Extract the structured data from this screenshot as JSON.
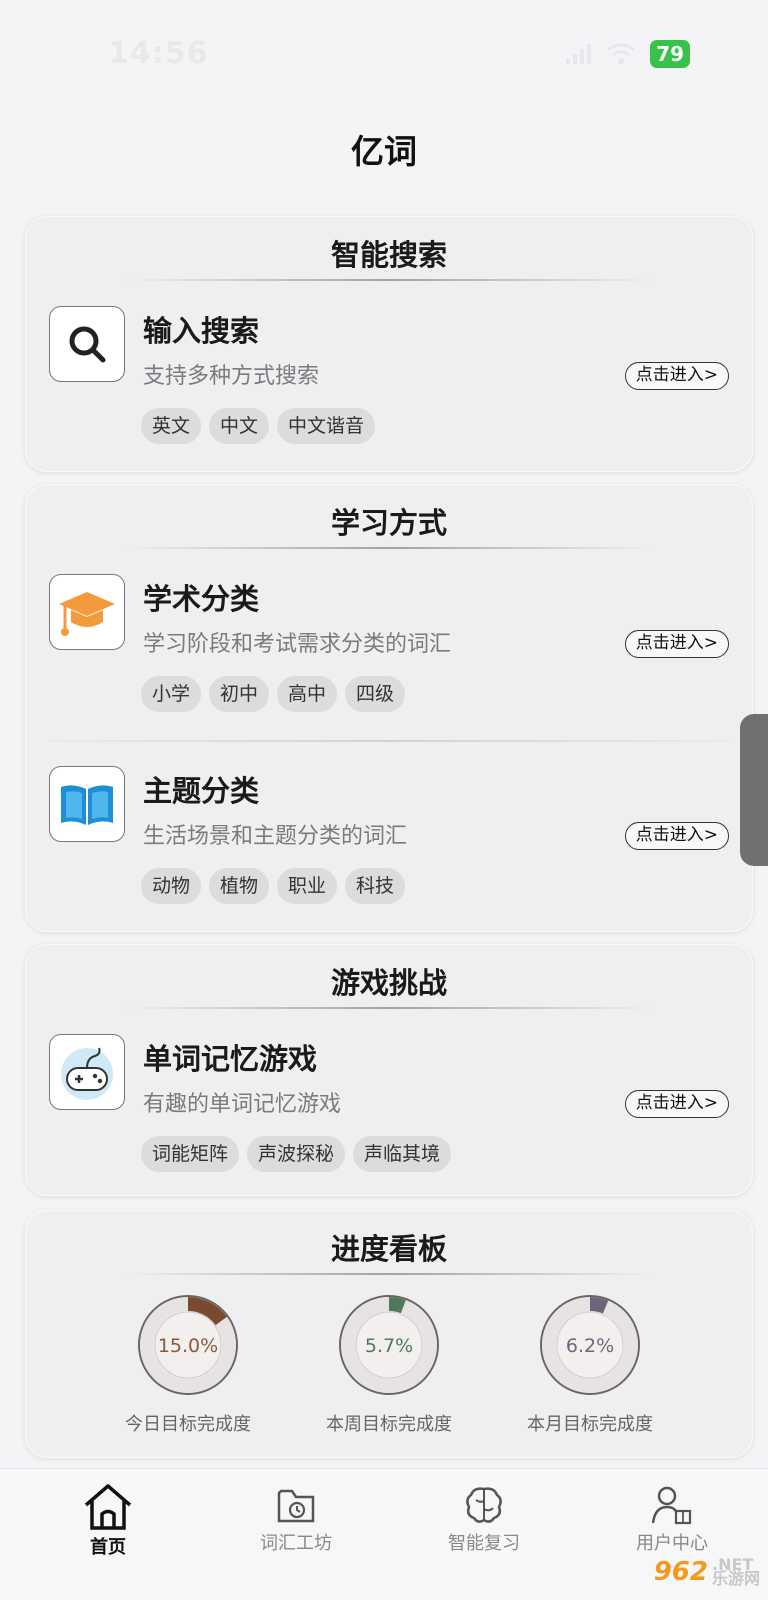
{
  "status_bar": {
    "time": "14:56",
    "battery": "79"
  },
  "app": {
    "title": "亿词"
  },
  "sections": {
    "search": {
      "title": "智能搜索",
      "items": [
        {
          "title": "输入搜索",
          "desc": "支持多种方式搜索",
          "button": "点击进入>",
          "icon": "search-icon",
          "tags": [
            "英文",
            "中文",
            "中文谐音"
          ]
        }
      ]
    },
    "study": {
      "title": "学习方式",
      "items": [
        {
          "title": "学术分类",
          "desc": "学习阶段和考试需求分类的词汇",
          "button": "点击进入>",
          "icon": "graduation-cap-icon",
          "tags": [
            "小学",
            "初中",
            "高中",
            "四级"
          ]
        },
        {
          "title": "主题分类",
          "desc": "生活场景和主题分类的词汇",
          "button": "点击进入>",
          "icon": "open-book-icon",
          "tags": [
            "动物",
            "植物",
            "职业",
            "科技"
          ]
        }
      ]
    },
    "game": {
      "title": "游戏挑战",
      "items": [
        {
          "title": "单词记忆游戏",
          "desc": "有趣的单词记忆游戏",
          "button": "点击进入>",
          "icon": "gamepad-icon",
          "tags": [
            "词能矩阵",
            "声波探秘",
            "声临其境"
          ]
        }
      ]
    },
    "progress": {
      "title": "进度看板",
      "rings": [
        {
          "label": "今日目标完成度",
          "value_text": "15.0%",
          "fraction": 0.15,
          "color": "#7a4a2e",
          "text_color": "#8a5a3c"
        },
        {
          "label": "本周目标完成度",
          "value_text": "5.7%",
          "fraction": 0.057,
          "color": "#4e7a5c",
          "text_color": "#4e7a5c"
        },
        {
          "label": "本月目标完成度",
          "value_text": "6.2%",
          "fraction": 0.062,
          "color": "#6e6678",
          "text_color": "#6e6678"
        }
      ]
    }
  },
  "tabbar": {
    "tabs": [
      {
        "label": "首页",
        "icon": "home-icon",
        "active": true
      },
      {
        "label": "词汇工坊",
        "icon": "history-folder-icon",
        "active": false
      },
      {
        "label": "智能复习",
        "icon": "brain-icon",
        "active": false
      },
      {
        "label": "用户中心",
        "icon": "user-book-icon",
        "active": false
      }
    ]
  },
  "watermark": {
    "logo": "962",
    "net": ".NET",
    "sub": "乐游网"
  }
}
